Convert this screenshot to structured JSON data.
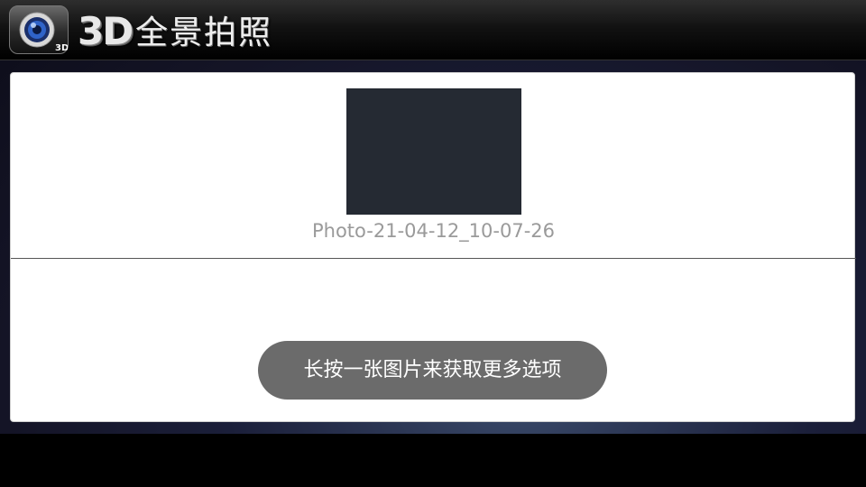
{
  "app": {
    "title_3d": "3D",
    "title_text": "全景拍照",
    "icon_badge": "3D"
  },
  "gallery": {
    "items": [
      {
        "name": "Photo-21-04-12_10-07-26"
      }
    ]
  },
  "toast": {
    "message": "长按一张图片来获取更多选项"
  }
}
